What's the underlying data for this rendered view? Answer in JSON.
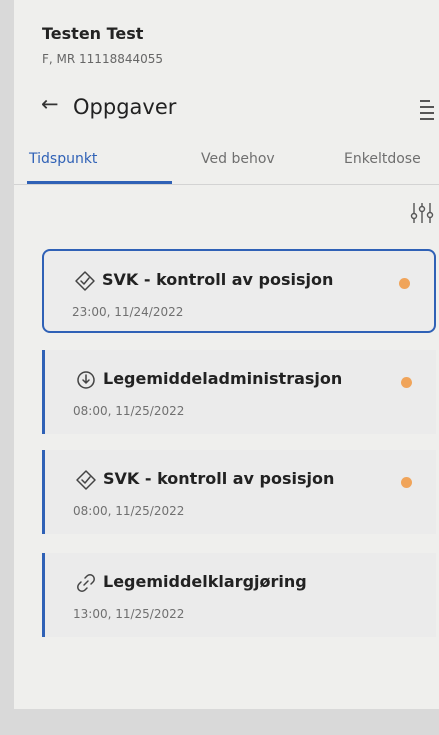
{
  "patient": {
    "name": "Testen Test",
    "id_line": "F, MR 11118844055"
  },
  "header": {
    "title": "Oppgaver",
    "back_icon": "arrow-left-icon",
    "menu_icon": "list-menu-icon"
  },
  "tabs": [
    {
      "label": "Tidspunkt",
      "active": true
    },
    {
      "label": "Ved behov",
      "active": false
    },
    {
      "label": "Enkeltdose",
      "active": false
    }
  ],
  "filter": {
    "icon": "filter-sliders-icon"
  },
  "tasks": [
    {
      "icon": "checkmark-badge-icon",
      "title": "SVK - kontroll av posisjon",
      "time": "23:00, 11/24/2022",
      "status_color": "#f0a45a",
      "selected": true
    },
    {
      "icon": "download-circle-icon",
      "title": "Legemiddeladministrasjon",
      "time": "08:00, 11/25/2022",
      "status_color": "#f0a45a",
      "selected": false
    },
    {
      "icon": "checkmark-badge-icon",
      "title": "SVK - kontroll av posisjon",
      "time": "08:00, 11/25/2022",
      "status_color": "#f0a45a",
      "selected": false
    },
    {
      "icon": "link-icon",
      "title": "Legemiddelklargjøring",
      "time": "13:00, 11/25/2022",
      "status_color": "",
      "selected": false
    }
  ],
  "colors": {
    "accent": "#2f61b6",
    "status": "#f0a45a",
    "background": "#efefed"
  }
}
